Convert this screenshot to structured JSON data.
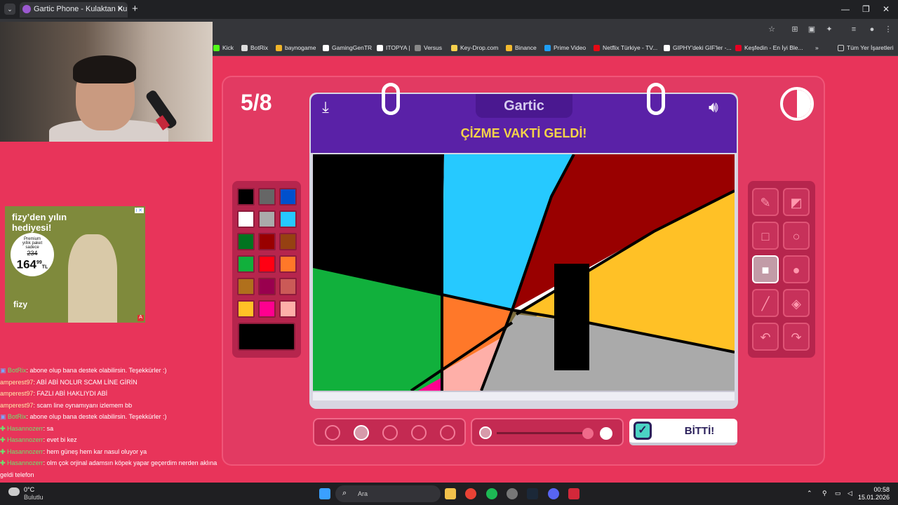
{
  "browser": {
    "tab_title": "Gartic Phone - Kulaktan Kulağa",
    "bookmarks": [
      {
        "label": "Kick",
        "color": "#53fc18"
      },
      {
        "label": "BotRix",
        "color": "#dddddd"
      },
      {
        "label": "baynogame",
        "color": "#f0b429"
      },
      {
        "label": "GamingGenTR",
        "color": "#ffffff"
      },
      {
        "label": "ITOPYA |",
        "color": "#ffffff"
      },
      {
        "label": "Versus",
        "color": "#888888"
      },
      {
        "label": "Key-Drop.com",
        "color": "#f6d04d"
      },
      {
        "label": "Binance",
        "color": "#f3ba2f"
      },
      {
        "label": "Prime Video",
        "color": "#1e9ef4"
      },
      {
        "label": "Netflix Türkiye - TV...",
        "color": "#e50914"
      },
      {
        "label": "GIPHY'deki GIF'ler -...",
        "color": "#ffffff"
      },
      {
        "label": "Keşfedin - En İyi Ble...",
        "color": "#e60023"
      }
    ],
    "more": "»",
    "all_bookmarks": "Tüm Yer İşaretleri"
  },
  "ad": {
    "title": "fizy’den yılın hediyesi!",
    "badge_line1": "Premium",
    "badge_line2": "yıllık paket",
    "badge_line3": "sadece",
    "old_price": "234",
    "price": "164",
    "price_cents": "99",
    "currency": "TL",
    "logo": "fizy"
  },
  "chat": [
    {
      "user": "BotRix",
      "msg": ": abone olup bana destek olabilirsin. Teşekkürler :)",
      "kind": "bot"
    },
    {
      "user": "amperest97",
      "msg": ": ABİ ABİ NOLUR SCAM LİNE GİRİN",
      "kind": "user"
    },
    {
      "user": "amperest97",
      "msg": ": FAZLI ABİ HAKLIYDI ABİ",
      "kind": "user"
    },
    {
      "user": "amperest97",
      "msg": ": scam line oynamıyanı izlemem bb",
      "kind": "user"
    },
    {
      "user": "BotRix",
      "msg": ": abone olup bana destek olabilirsin. Teşekkürler :)",
      "kind": "bot"
    },
    {
      "user": "Hasannozerr",
      "msg": ": sa",
      "kind": "sub"
    },
    {
      "user": "Hasannozerr",
      "msg": ": evet bi kez",
      "kind": "sub"
    },
    {
      "user": "Hasannozerr",
      "msg": ": hem güneş hem kar nasul oluyor ya",
      "kind": "sub"
    },
    {
      "user": "Hasannozerr",
      "msg": ": olm çok orjinal adamsın köpek yapar geçerdim nerden aklına",
      "kind": "sub"
    },
    {
      "user": "",
      "msg": "geldi telefon",
      "kind": "cont"
    }
  ],
  "game": {
    "round": "5/8",
    "logo": "Gartic",
    "title": "ÇİZME VAKTİ GELDİ!",
    "done_label": "BİTTİ!",
    "palette": [
      "#000000",
      "#666666",
      "#0050cd",
      "#ffffff",
      "#aaaaaa",
      "#26c9ff",
      "#017420",
      "#990000",
      "#964112",
      "#11b03c",
      "#ff0013",
      "#ff7829",
      "#b0701c",
      "#99004e",
      "#cb5a57",
      "#ffc126",
      "#ff008f",
      "#feafa8"
    ],
    "selected_color": "#000000",
    "tools": [
      "pencil",
      "eraser",
      "rect-outline",
      "circle-outline",
      "rect-filled",
      "circle-filled",
      "line",
      "fill-bucket",
      "undo",
      "redo"
    ],
    "selected_tool": "rect-filled",
    "brush_sizes": 5,
    "selected_size_index": 1,
    "opacity": 1.0
  },
  "taskbar": {
    "weather_temp": "0°C",
    "weather_desc": "Bulutlu",
    "search_placeholder": "Ara",
    "time": "00:58",
    "date": "15.01.2026"
  }
}
